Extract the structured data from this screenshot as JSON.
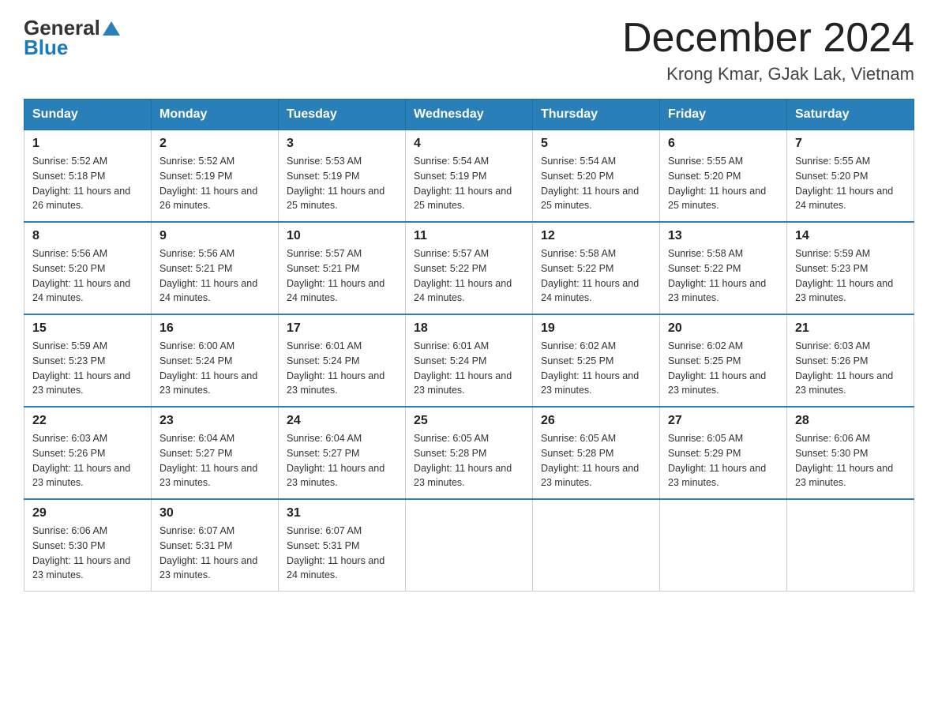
{
  "header": {
    "logo_text1": "General",
    "logo_text2": "Blue",
    "month": "December 2024",
    "location": "Krong Kmar, GJak Lak, Vietnam"
  },
  "days_of_week": [
    "Sunday",
    "Monday",
    "Tuesday",
    "Wednesday",
    "Thursday",
    "Friday",
    "Saturday"
  ],
  "weeks": [
    [
      {
        "day": "1",
        "sunrise": "5:52 AM",
        "sunset": "5:18 PM",
        "daylight": "11 hours and 26 minutes."
      },
      {
        "day": "2",
        "sunrise": "5:52 AM",
        "sunset": "5:19 PM",
        "daylight": "11 hours and 26 minutes."
      },
      {
        "day": "3",
        "sunrise": "5:53 AM",
        "sunset": "5:19 PM",
        "daylight": "11 hours and 25 minutes."
      },
      {
        "day": "4",
        "sunrise": "5:54 AM",
        "sunset": "5:19 PM",
        "daylight": "11 hours and 25 minutes."
      },
      {
        "day": "5",
        "sunrise": "5:54 AM",
        "sunset": "5:20 PM",
        "daylight": "11 hours and 25 minutes."
      },
      {
        "day": "6",
        "sunrise": "5:55 AM",
        "sunset": "5:20 PM",
        "daylight": "11 hours and 25 minutes."
      },
      {
        "day": "7",
        "sunrise": "5:55 AM",
        "sunset": "5:20 PM",
        "daylight": "11 hours and 24 minutes."
      }
    ],
    [
      {
        "day": "8",
        "sunrise": "5:56 AM",
        "sunset": "5:20 PM",
        "daylight": "11 hours and 24 minutes."
      },
      {
        "day": "9",
        "sunrise": "5:56 AM",
        "sunset": "5:21 PM",
        "daylight": "11 hours and 24 minutes."
      },
      {
        "day": "10",
        "sunrise": "5:57 AM",
        "sunset": "5:21 PM",
        "daylight": "11 hours and 24 minutes."
      },
      {
        "day": "11",
        "sunrise": "5:57 AM",
        "sunset": "5:22 PM",
        "daylight": "11 hours and 24 minutes."
      },
      {
        "day": "12",
        "sunrise": "5:58 AM",
        "sunset": "5:22 PM",
        "daylight": "11 hours and 24 minutes."
      },
      {
        "day": "13",
        "sunrise": "5:58 AM",
        "sunset": "5:22 PM",
        "daylight": "11 hours and 23 minutes."
      },
      {
        "day": "14",
        "sunrise": "5:59 AM",
        "sunset": "5:23 PM",
        "daylight": "11 hours and 23 minutes."
      }
    ],
    [
      {
        "day": "15",
        "sunrise": "5:59 AM",
        "sunset": "5:23 PM",
        "daylight": "11 hours and 23 minutes."
      },
      {
        "day": "16",
        "sunrise": "6:00 AM",
        "sunset": "5:24 PM",
        "daylight": "11 hours and 23 minutes."
      },
      {
        "day": "17",
        "sunrise": "6:01 AM",
        "sunset": "5:24 PM",
        "daylight": "11 hours and 23 minutes."
      },
      {
        "day": "18",
        "sunrise": "6:01 AM",
        "sunset": "5:24 PM",
        "daylight": "11 hours and 23 minutes."
      },
      {
        "day": "19",
        "sunrise": "6:02 AM",
        "sunset": "5:25 PM",
        "daylight": "11 hours and 23 minutes."
      },
      {
        "day": "20",
        "sunrise": "6:02 AM",
        "sunset": "5:25 PM",
        "daylight": "11 hours and 23 minutes."
      },
      {
        "day": "21",
        "sunrise": "6:03 AM",
        "sunset": "5:26 PM",
        "daylight": "11 hours and 23 minutes."
      }
    ],
    [
      {
        "day": "22",
        "sunrise": "6:03 AM",
        "sunset": "5:26 PM",
        "daylight": "11 hours and 23 minutes."
      },
      {
        "day": "23",
        "sunrise": "6:04 AM",
        "sunset": "5:27 PM",
        "daylight": "11 hours and 23 minutes."
      },
      {
        "day": "24",
        "sunrise": "6:04 AM",
        "sunset": "5:27 PM",
        "daylight": "11 hours and 23 minutes."
      },
      {
        "day": "25",
        "sunrise": "6:05 AM",
        "sunset": "5:28 PM",
        "daylight": "11 hours and 23 minutes."
      },
      {
        "day": "26",
        "sunrise": "6:05 AM",
        "sunset": "5:28 PM",
        "daylight": "11 hours and 23 minutes."
      },
      {
        "day": "27",
        "sunrise": "6:05 AM",
        "sunset": "5:29 PM",
        "daylight": "11 hours and 23 minutes."
      },
      {
        "day": "28",
        "sunrise": "6:06 AM",
        "sunset": "5:30 PM",
        "daylight": "11 hours and 23 minutes."
      }
    ],
    [
      {
        "day": "29",
        "sunrise": "6:06 AM",
        "sunset": "5:30 PM",
        "daylight": "11 hours and 23 minutes."
      },
      {
        "day": "30",
        "sunrise": "6:07 AM",
        "sunset": "5:31 PM",
        "daylight": "11 hours and 23 minutes."
      },
      {
        "day": "31",
        "sunrise": "6:07 AM",
        "sunset": "5:31 PM",
        "daylight": "11 hours and 24 minutes."
      },
      null,
      null,
      null,
      null
    ]
  ]
}
